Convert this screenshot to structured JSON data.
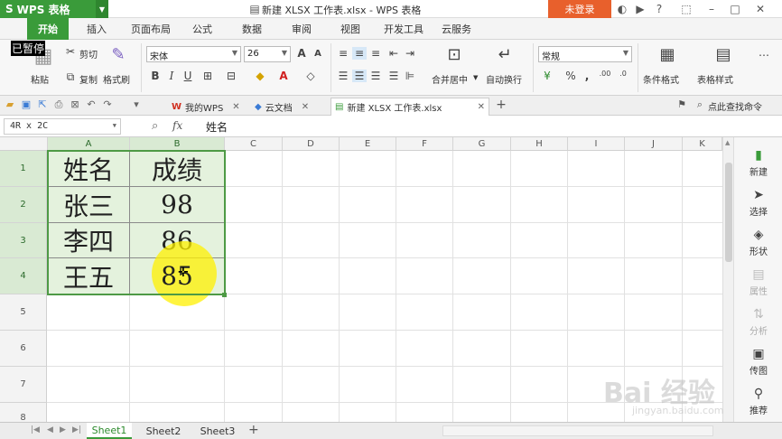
{
  "titlebar": {
    "app_logo": "S",
    "app_name": "WPS 表格",
    "doc_title": "新建 XLSX 工作表.xlsx - WPS 表格",
    "login_label": "未登录",
    "help_label": "?"
  },
  "menu": {
    "tabs": [
      {
        "label": "开始",
        "active": true
      },
      {
        "label": "插入"
      },
      {
        "label": "页面布局"
      },
      {
        "label": "公式"
      },
      {
        "label": "数据"
      },
      {
        "label": "审阅"
      },
      {
        "label": "视图"
      },
      {
        "label": "开发工具"
      },
      {
        "label": "云服务"
      }
    ]
  },
  "ribbon": {
    "cut": "剪切",
    "paste": "粘贴",
    "copy": "复制",
    "format_painter": "格式刷",
    "font_name": "宋体",
    "font_size": "26",
    "bold": "B",
    "italic": "I",
    "underline": "U",
    "merge_center": "合并居中",
    "wrap_text": "自动换行",
    "number_format": "常规",
    "percent": "%",
    "comma": ",",
    "cond_format": "条件格式",
    "table_style": "表格样式",
    "paused_overlay": "已暂停"
  },
  "doctabs": {
    "tabs": [
      {
        "label": "我的WPS"
      },
      {
        "label": "云文档"
      },
      {
        "label": "新建 XLSX 工作表.xlsx",
        "active": true
      }
    ],
    "search_label": "点此查找命令"
  },
  "formulabar": {
    "name_box": "4R x 2C",
    "fx": "fx",
    "content": "姓名"
  },
  "sheet": {
    "columns": [
      "A",
      "B",
      "C",
      "D",
      "E",
      "F",
      "G",
      "H",
      "I",
      "J",
      "K"
    ],
    "rows": [
      "1",
      "2",
      "3",
      "4",
      "5",
      "6",
      "7",
      "8"
    ],
    "cells": [
      [
        "姓名",
        "成绩"
      ],
      [
        "张三",
        "98"
      ],
      [
        "李四",
        "86"
      ],
      [
        "王五",
        "85"
      ]
    ]
  },
  "sidepanel": {
    "items": [
      {
        "label": "新建"
      },
      {
        "label": "选择"
      },
      {
        "label": "形状"
      },
      {
        "label": "属性",
        "disabled": true
      },
      {
        "label": "分析",
        "disabled": true
      },
      {
        "label": "传图"
      },
      {
        "label": "推荐"
      }
    ]
  },
  "sheettabs": {
    "tabs": [
      {
        "label": "Sheet1",
        "active": true
      },
      {
        "label": "Sheet2"
      },
      {
        "label": "Sheet3"
      }
    ],
    "add_label": "+"
  },
  "watermark": {
    "text": "Bai 经验",
    "sub": "jingyan.baidu.com"
  },
  "colors": {
    "accent": "#3a9b3a",
    "login": "#e8602c",
    "selection_fill": "#e4f2dd",
    "selection_border": "#4e9a45",
    "highlight": "#fff000"
  }
}
